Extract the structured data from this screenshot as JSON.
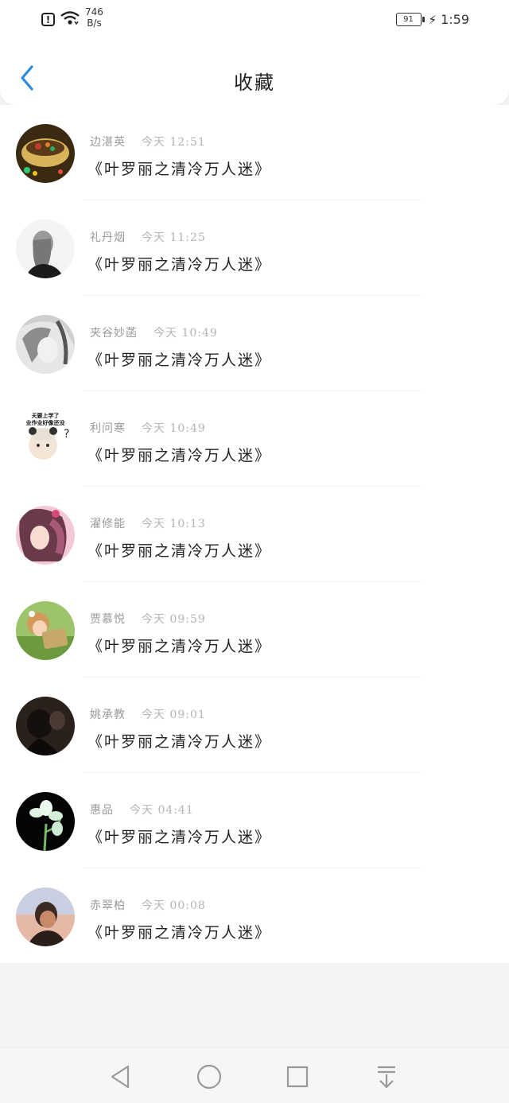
{
  "status_bar": {
    "net_speed_value": "746",
    "net_speed_unit": "B/s",
    "battery_level": "91",
    "time": "1:59",
    "alert_glyph": "!"
  },
  "header": {
    "title": "收藏",
    "back_icon": "chevron-left-icon",
    "accent_color": "#2b8bd8"
  },
  "favorites": [
    {
      "name": "边湛英",
      "time": "今天 12:51",
      "title": "《叶罗丽之清冷万人迷》",
      "avatar": "food-bowl"
    },
    {
      "name": "礼丹烟",
      "time": "今天 11:25",
      "title": "《叶罗丽之清冷万人迷》",
      "avatar": "girl-sketch"
    },
    {
      "name": "夹谷妙菡",
      "time": "今天 10:49",
      "title": "《叶罗丽之清冷万人迷》",
      "avatar": "anime-gray"
    },
    {
      "name": "利问寒",
      "time": "今天 10:49",
      "title": "《叶罗丽之清冷万人迷》",
      "avatar": "panda-meme"
    },
    {
      "name": "濯修能",
      "time": "今天 10:13",
      "title": "《叶罗丽之清冷万人迷》",
      "avatar": "anime-pink"
    },
    {
      "name": "贾慕悦",
      "time": "今天 09:59",
      "title": "《叶罗丽之清冷万人迷》",
      "avatar": "girl-book"
    },
    {
      "name": "姚承教",
      "time": "今天 09:01",
      "title": "《叶罗丽之清冷万人迷》",
      "avatar": "dark-person"
    },
    {
      "name": "惠品",
      "time": "今天 04:41",
      "title": "《叶罗丽之清冷万人迷》",
      "avatar": "white-flower"
    },
    {
      "name": "赤翠柏",
      "time": "今天 00:08",
      "title": "《叶罗丽之清冷万人迷》",
      "avatar": "boy-sunset"
    }
  ],
  "nav_bar": {
    "back": "triangle-back-icon",
    "home": "circle-home-icon",
    "recents": "square-recents-icon",
    "notifications": "pull-down-icon"
  },
  "panda_meme_text": [
    "天要上学了",
    "业作业好像还没"
  ]
}
